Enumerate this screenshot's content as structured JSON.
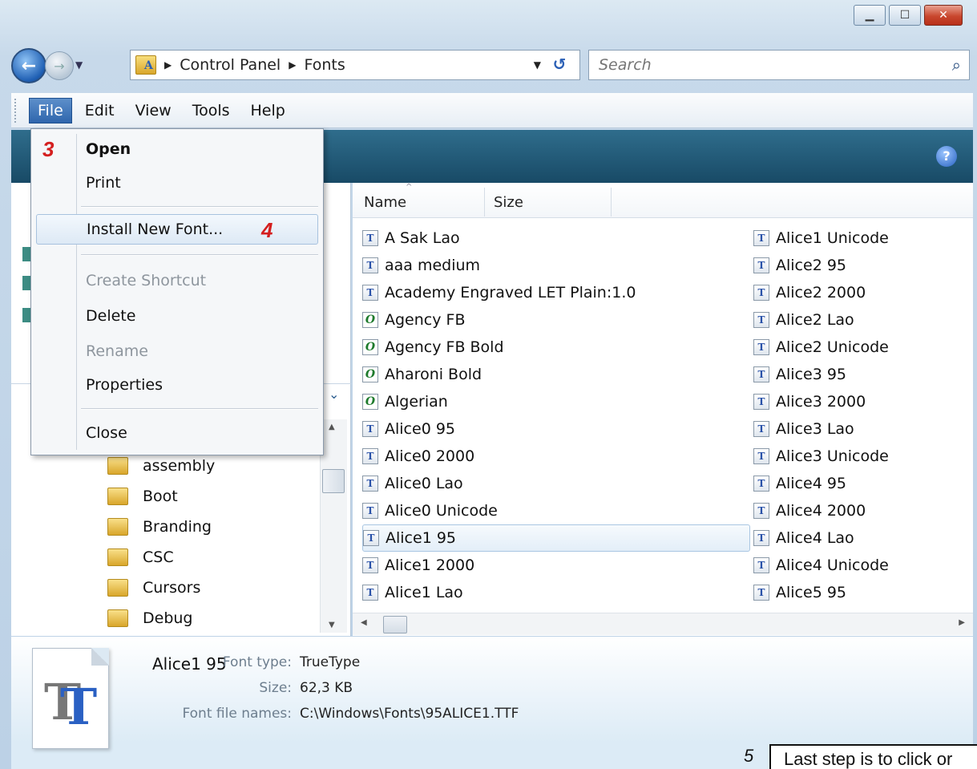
{
  "window": {
    "caption_buttons": [
      "minimize-icon",
      "maximize-icon",
      "close-icon"
    ]
  },
  "address": {
    "crumbs": [
      "Control Panel",
      "Fonts"
    ],
    "folder_glyph": "A"
  },
  "search": {
    "placeholder": "Search"
  },
  "menubar": [
    "File",
    "Edit",
    "View",
    "Tools",
    "Help"
  ],
  "file_menu": {
    "items": [
      {
        "label": "Open"
      },
      {
        "label": "Print"
      },
      {
        "label": "Install New Font..."
      },
      {
        "label": "Create Shortcut"
      },
      {
        "label": "Delete"
      },
      {
        "label": "Rename"
      },
      {
        "label": "Properties"
      },
      {
        "label": "Close"
      }
    ],
    "step3": "3",
    "step4": "4"
  },
  "columns": {
    "name": "Name",
    "size": "Size"
  },
  "fonts_left": [
    {
      "name": "A Sak Lao",
      "type": "T"
    },
    {
      "name": "aaa medium",
      "type": "T"
    },
    {
      "name": "Academy Engraved LET Plain:1.0",
      "type": "T"
    },
    {
      "name": "Agency FB",
      "type": "O"
    },
    {
      "name": "Agency FB Bold",
      "type": "O"
    },
    {
      "name": "Aharoni Bold",
      "type": "O"
    },
    {
      "name": "Algerian",
      "type": "O"
    },
    {
      "name": "Alice0 95",
      "type": "T"
    },
    {
      "name": "Alice0 2000",
      "type": "T"
    },
    {
      "name": "Alice0 Lao",
      "type": "T"
    },
    {
      "name": "Alice0 Unicode",
      "type": "T"
    },
    {
      "name": "Alice1 95",
      "type": "T"
    },
    {
      "name": "Alice1 2000",
      "type": "T"
    },
    {
      "name": "Alice1 Lao",
      "type": "T"
    }
  ],
  "fonts_right": [
    {
      "name": "Alice1 Unicode",
      "type": "T"
    },
    {
      "name": "Alice2 95",
      "type": "T"
    },
    {
      "name": "Alice2 2000",
      "type": "T"
    },
    {
      "name": "Alice2 Lao",
      "type": "T"
    },
    {
      "name": "Alice2 Unicode",
      "type": "T"
    },
    {
      "name": "Alice3 95",
      "type": "T"
    },
    {
      "name": "Alice3 2000",
      "type": "T"
    },
    {
      "name": "Alice3 Lao",
      "type": "T"
    },
    {
      "name": "Alice3 Unicode",
      "type": "T"
    },
    {
      "name": "Alice4 95",
      "type": "T"
    },
    {
      "name": "Alice4 2000",
      "type": "T"
    },
    {
      "name": "Alice4 Lao",
      "type": "T"
    },
    {
      "name": "Alice4 Unicode",
      "type": "T"
    },
    {
      "name": "Alice5 95",
      "type": "T"
    }
  ],
  "tree": [
    "assembly",
    "Boot",
    "Branding",
    "CSC",
    "Cursors",
    "Debug"
  ],
  "details": {
    "name": "Alice1 95",
    "type_label": "Font type:",
    "type_value": "TrueType",
    "size_label": "Size:",
    "size_value": "62,3 KB",
    "files_label": "Font file names:",
    "files_value": "C:\\Windows\\Fonts\\95ALICE1.TTF"
  },
  "callout": {
    "text": "Last step is to click or",
    "number": "5"
  },
  "colors": {
    "accent": "#2f66ad",
    "step_red": "#d41f1f",
    "cmdbar": "#184a66"
  }
}
